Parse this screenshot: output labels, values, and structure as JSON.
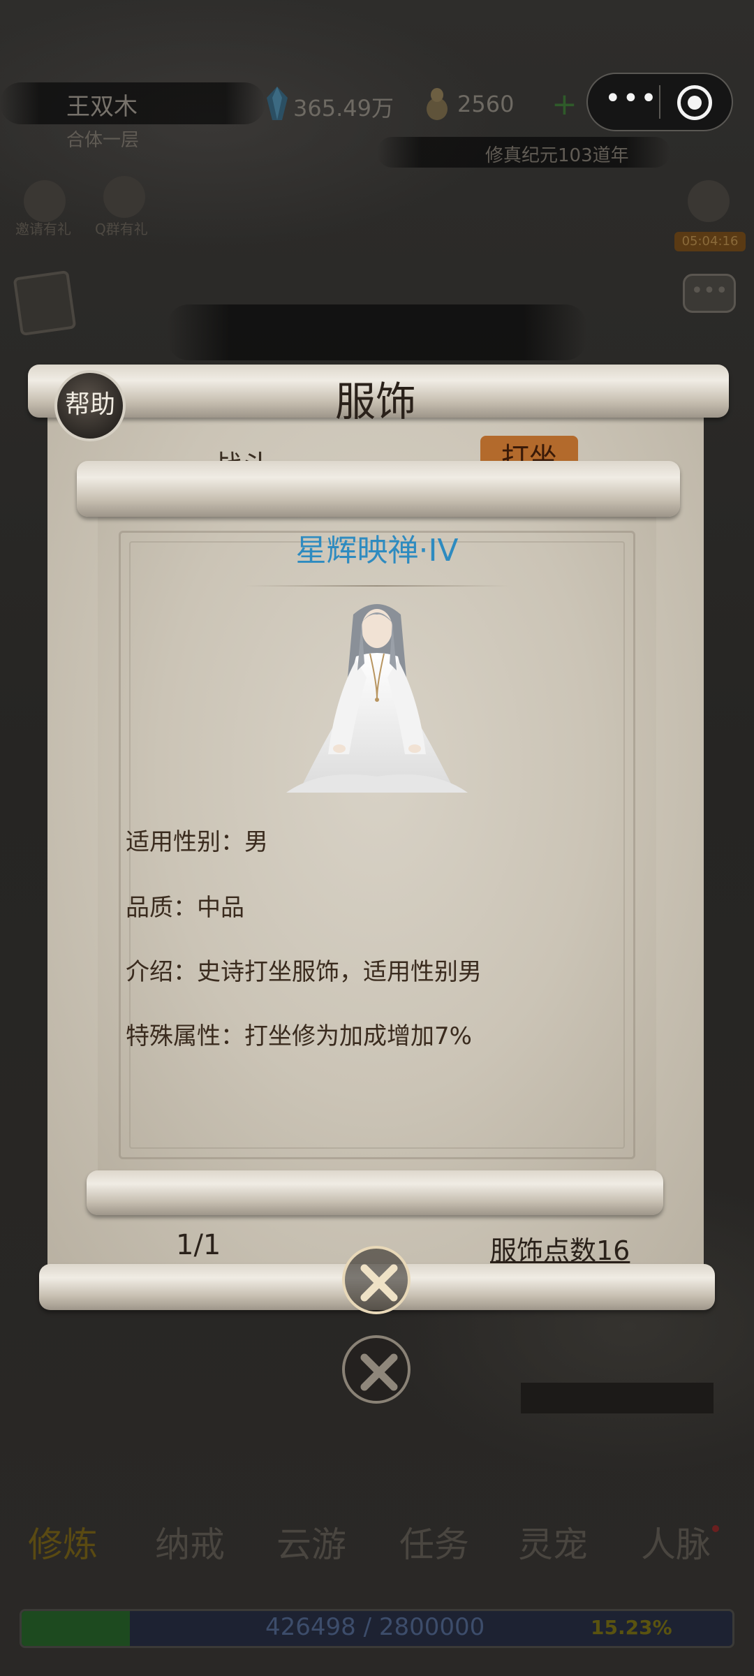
{
  "header": {
    "player_name": "王双木",
    "realm": "合体一层",
    "gems": "365.49万",
    "coins": "2560",
    "era": "修真纪元103道年",
    "plus_icon": "plus-icon",
    "menu_icon": "more-dots-icon",
    "target_icon": "target-icon"
  },
  "gifts": {
    "invite_label": "邀请有礼",
    "qq_label": "Q群有礼",
    "timer": "05:04:16"
  },
  "panel": {
    "title": "服饰",
    "help_label": "帮助",
    "tab_fight": "战斗",
    "tab_meditate": "打坐",
    "page": "1/1",
    "costume_points": "服饰点数16"
  },
  "detail": {
    "name": "星辉映禅·IV",
    "gender_key": "适用性别：",
    "gender_value": "男",
    "quality_key": "品质：",
    "quality_value": "中品",
    "intro_key": "介绍：",
    "intro_value": "史诗打坐服饰，适用性别男",
    "special_key": "特殊属性：",
    "special_value": "打坐修为加成增加7%"
  },
  "bottom_nav": {
    "items": [
      "修炼",
      "纳戒",
      "云游",
      "任务",
      "灵宠",
      "人脉"
    ]
  },
  "exp": {
    "text": "426498 / 2800000",
    "percent": "15.23%",
    "fill_fraction": 0.1523
  },
  "colors": {
    "name_blue": "#2e8bc0",
    "paper": "#cbc4b6",
    "meditate_tab": "#b36a2c"
  }
}
